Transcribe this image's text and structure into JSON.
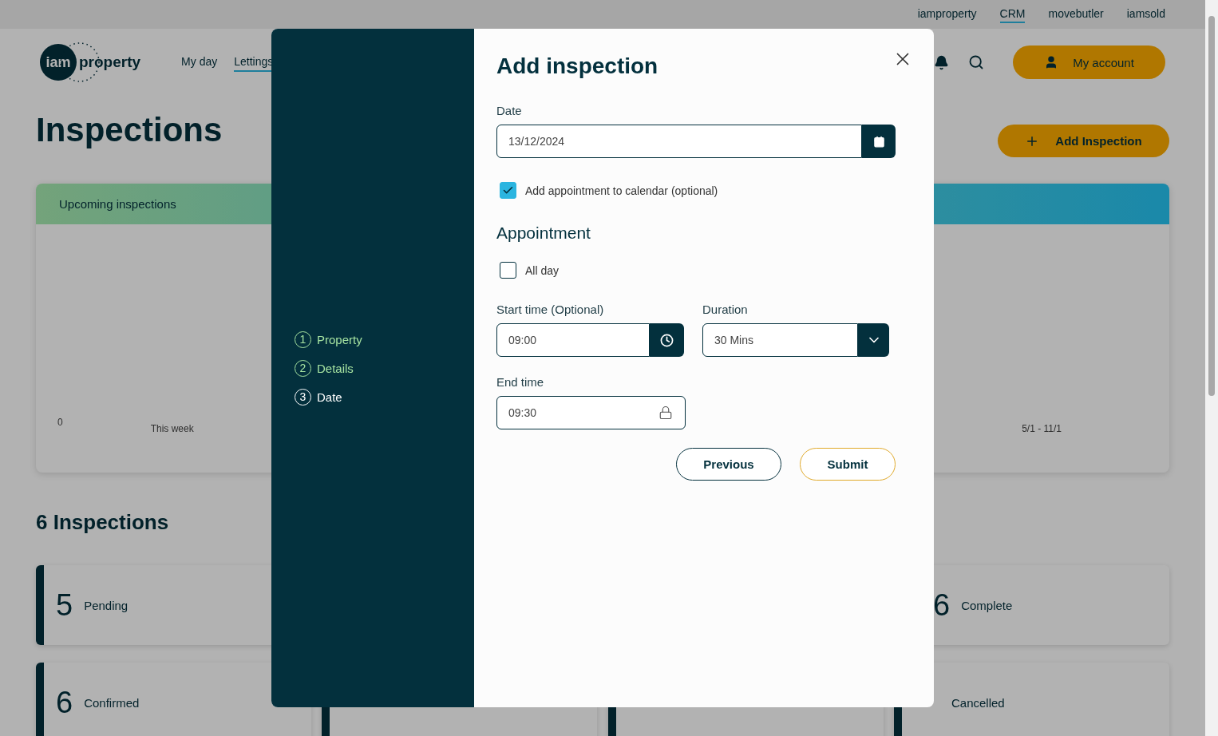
{
  "top_bar": {
    "links": [
      {
        "label": "iamproperty",
        "selected": false
      },
      {
        "label": "CRM",
        "selected": true
      },
      {
        "label": "movebutler",
        "selected": false
      },
      {
        "label": "iamsold",
        "selected": false
      }
    ]
  },
  "header": {
    "logo": {
      "badge": "iam",
      "word": "property"
    },
    "nav": [
      {
        "label": "My day",
        "selected": false
      },
      {
        "label": "Lettings",
        "selected": true
      }
    ],
    "account_button": "My account"
  },
  "page": {
    "title": "Inspections",
    "add_button": "Add Inspection"
  },
  "chart_card": {
    "title": "Upcoming inspections",
    "y_label": "0",
    "x_labels": [
      "This week",
      "5/1 - 11/1"
    ]
  },
  "summary": {
    "title": "6 Inspections",
    "rows": [
      [
        {
          "kind": "stat",
          "count": "5",
          "label": "Pending"
        },
        {
          "kind": "stat",
          "count": "6",
          "label": "Complete"
        }
      ],
      [
        {
          "kind": "stat",
          "count": "6",
          "label": "Confirmed"
        },
        {
          "kind": "covered"
        },
        {
          "kind": "covered"
        },
        {
          "kind": "stat",
          "label": "Cancelled"
        }
      ]
    ]
  },
  "modal": {
    "steps": [
      {
        "number": "1",
        "label": "Property",
        "selected": false
      },
      {
        "number": "2",
        "label": "Details",
        "selected": false
      },
      {
        "number": "3",
        "label": "Date",
        "selected": true
      }
    ],
    "title": "Add inspection",
    "date": {
      "label": "Date",
      "value": "13/12/2024"
    },
    "calendar_option": {
      "label": "Add appointment to calendar (optional)",
      "checked": true
    },
    "appointment_heading": "Appointment",
    "all_day": {
      "label": "All day",
      "checked": false
    },
    "start_time": {
      "label": "Start time (Optional)",
      "value": "09:00"
    },
    "duration": {
      "label": "Duration",
      "value": "30 Mins"
    },
    "end_time": {
      "label": "End time",
      "value": "09:30"
    },
    "buttons": {
      "previous": "Previous",
      "submit": "Submit"
    }
  }
}
